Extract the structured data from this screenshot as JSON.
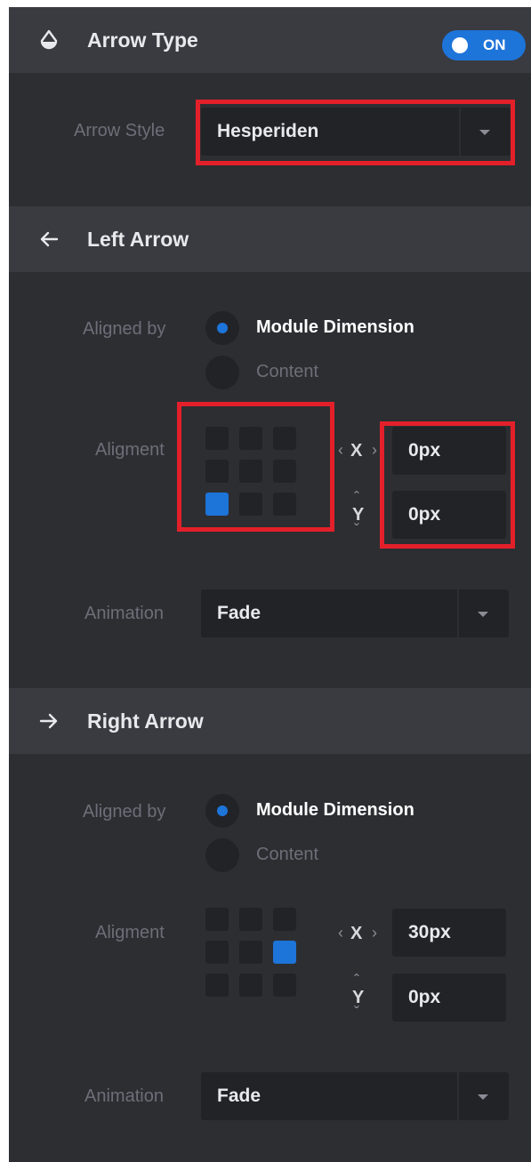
{
  "arrow_type": {
    "title": "Arrow Type",
    "toggle_label": "ON",
    "arrow_style_label": "Arrow Style",
    "arrow_style_value": "Hesperiden"
  },
  "left_arrow": {
    "title": "Left Arrow",
    "aligned_by_label": "Aligned by",
    "options": [
      "Module Dimension",
      "Content"
    ],
    "selected_option": "Module Dimension",
    "alignment_label": "Aligment",
    "alignment_selected": "bottom-left",
    "x_value": "0px",
    "y_value": "0px",
    "animation_label": "Animation",
    "animation_value": "Fade"
  },
  "right_arrow": {
    "title": "Right Arrow",
    "aligned_by_label": "Aligned by",
    "options": [
      "Module Dimension",
      "Content"
    ],
    "selected_option": "Module Dimension",
    "alignment_label": "Aligment",
    "alignment_selected": "middle-right",
    "x_value": "30px",
    "y_value": "0px",
    "animation_label": "Animation",
    "animation_value": "Fade"
  },
  "axis": {
    "x": "X",
    "y": "Y"
  },
  "colors": {
    "panel_bg": "#2d2e32",
    "header_bg": "#3a3b41",
    "input_bg": "#222327",
    "accent": "#1d74d9",
    "highlight": "#e3202a"
  },
  "icons": {
    "arrow_type": "droplet-icon",
    "left_arrow": "arrow-left-icon",
    "right_arrow": "arrow-right-icon",
    "dropdown": "caret-down-icon"
  }
}
